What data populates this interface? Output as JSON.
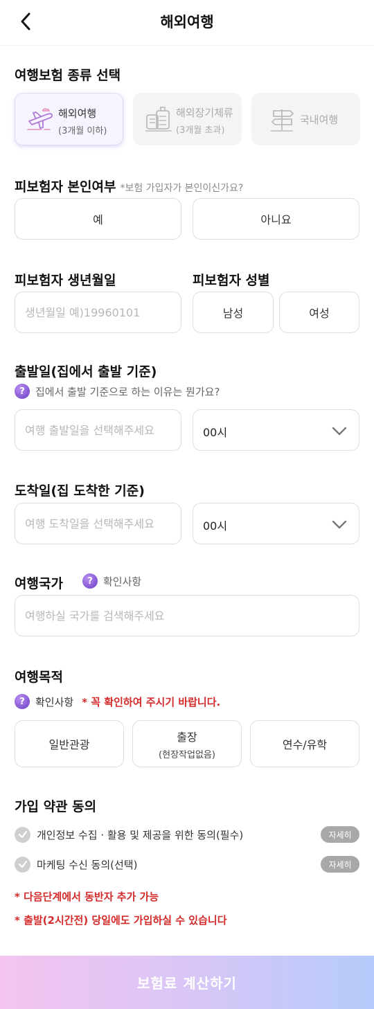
{
  "header": {
    "title": "해외여행"
  },
  "insurance_type": {
    "title": "여행보험 종류 선택",
    "options": [
      {
        "label": "해외여행",
        "sub": "(3개월 이하)",
        "icon": "airplane-icon",
        "state": "selected"
      },
      {
        "label": "해외장기체류",
        "sub": "(3개월 초과)",
        "icon": "luggage-icon",
        "state": "disabled"
      },
      {
        "label": "국내여행",
        "icon": "signpost-icon",
        "state": "disabled"
      }
    ]
  },
  "insured_self": {
    "title": "피보험자 본인여부",
    "hint": "*보험 가입자가 본인이신가요?",
    "yes": "예",
    "no": "아니요"
  },
  "birth": {
    "title": "피보험자 생년월일",
    "placeholder": "생년월일 예)19960101"
  },
  "gender": {
    "title": "피보험자 성별",
    "male": "남성",
    "female": "여성"
  },
  "departure": {
    "title": "출발일(집에서 출발 기준)",
    "help": "집에서 출발 기준으로 하는 이유는 뭔가요?",
    "placeholder": "여행 출발일을 선택해주세요",
    "hour": "00시"
  },
  "arrival": {
    "title": "도착일(집 도착한 기준)",
    "placeholder": "여행 도착일을 선택해주세요",
    "hour": "00시"
  },
  "country": {
    "title": "여행국가",
    "help": "확인사항",
    "placeholder": "여행하실 국가를 검색해주세요"
  },
  "purpose": {
    "title": "여행목적",
    "help": "확인사항",
    "warning": "* 꼭 확인하여 주시기 바랍니다.",
    "options": [
      {
        "label": "일반관광"
      },
      {
        "label": "출장",
        "sub": "(현장작업없음)"
      },
      {
        "label": "연수/유학"
      }
    ]
  },
  "terms": {
    "title": "가입 약관 동의",
    "items": [
      {
        "label": "개인정보 수집 · 활용 및 제공을 위한 동의(필수)",
        "detail": "자세히"
      },
      {
        "label": "마케팅 수신 동의(선택)",
        "detail": "자세히"
      }
    ]
  },
  "notices": [
    "* 다음단계에서 동반자 추가 가능",
    "* 출발(2시간전) 당일에도 가입하실 수 있습니다"
  ],
  "cta": {
    "label": "보험료 계산하기"
  },
  "colors": {
    "accent_purple": "#6b3fc8",
    "warning_red": "#d42a2a",
    "cta_gradient_start": "#f4c4ef",
    "cta_gradient_end": "#b5cbfb"
  }
}
